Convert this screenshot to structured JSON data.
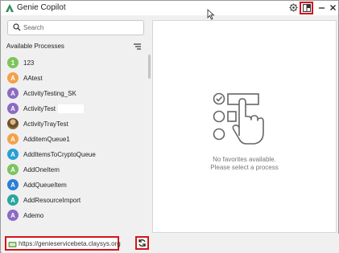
{
  "app": {
    "title": "Genie Copilot"
  },
  "search": {
    "placeholder": "Search"
  },
  "processes": {
    "header": "Available Processes",
    "items": [
      {
        "avatar": "1",
        "label": "123",
        "color": "#7dc45e"
      },
      {
        "avatar": "A",
        "label": "AAtest",
        "color": "#f4a14a"
      },
      {
        "avatar": "A",
        "label": "ActivityTesting_SK",
        "color": "#8b6bc3"
      },
      {
        "avatar": "A",
        "label": "ActivityTest",
        "color": "#8b6bc3"
      },
      {
        "avatar": "",
        "label": "ActivityTrayTest",
        "color": "#8a6d3b"
      },
      {
        "avatar": "A",
        "label": "AdditemQueue1",
        "color": "#f4a14a"
      },
      {
        "avatar": "A",
        "label": "AddItemsToCryptoQueue",
        "color": "#2a9fd6"
      },
      {
        "avatar": "A",
        "label": "AddOneItem",
        "color": "#7dc45e"
      },
      {
        "avatar": "A",
        "label": "AddQueueItem",
        "color": "#2a7fd6"
      },
      {
        "avatar": "A",
        "label": "AddResourceImport",
        "color": "#2aa6a0"
      },
      {
        "avatar": "A",
        "label": "Ademo",
        "color": "#8b6bc3"
      }
    ]
  },
  "footer": {
    "url": "https://genieservicebeta.claysys.org"
  },
  "empty_state": {
    "line1": "No favorites available.",
    "line2": "Please select a process"
  },
  "colors": {
    "highlight": "#d4141c",
    "brand": "#2e8b57"
  }
}
